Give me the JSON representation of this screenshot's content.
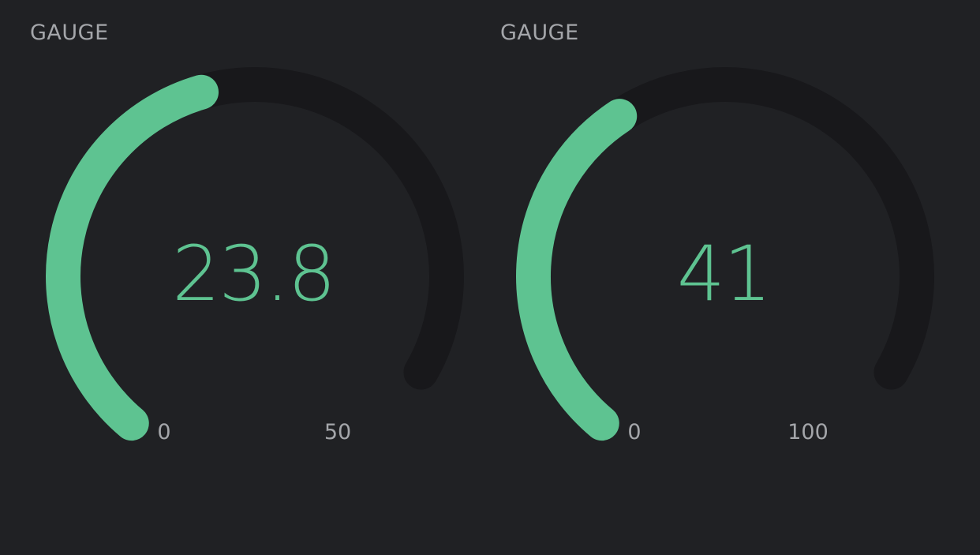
{
  "colors": {
    "background": "#202124",
    "track": "#18181b",
    "accent": "#5ec391",
    "label": "#a4a6aa"
  },
  "gauges": [
    {
      "title": "GAUGE",
      "value": 23.8,
      "value_label": "23.8",
      "min": 0,
      "min_label": "0",
      "max": 50,
      "max_label": "50"
    },
    {
      "title": "GAUGE",
      "value": 41,
      "value_label": "41",
      "min": 0,
      "min_label": "0",
      "max": 100,
      "max_label": "100"
    }
  ]
}
